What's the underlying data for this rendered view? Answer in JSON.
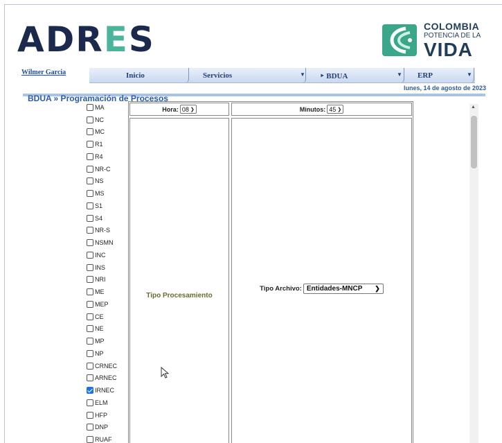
{
  "header": {
    "logo_left": "ADRES",
    "logo_right": {
      "line1": "COLOMBIA",
      "line2": "POTENCIA DE LA",
      "line3": "VIDA"
    }
  },
  "nav": {
    "user": "Wilmer Garcia",
    "items": [
      {
        "label": "Inicio"
      },
      {
        "label": "Servicios"
      },
      {
        "label": "‣ BDUA"
      },
      {
        "label": "ERP"
      }
    ],
    "date": "lunes, 14 de agosto de 2023"
  },
  "breadcrumb": "BDUA » Programación de Procesos",
  "checkboxes": [
    {
      "label": "MA",
      "checked": false
    },
    {
      "label": "NC",
      "checked": false
    },
    {
      "label": "MC",
      "checked": false
    },
    {
      "label": "R1",
      "checked": false
    },
    {
      "label": "R4",
      "checked": false
    },
    {
      "label": "NR-C",
      "checked": false
    },
    {
      "label": "NS",
      "checked": false
    },
    {
      "label": "MS",
      "checked": false
    },
    {
      "label": "S1",
      "checked": false
    },
    {
      "label": "S4",
      "checked": false
    },
    {
      "label": "NR-S",
      "checked": false
    },
    {
      "label": "NSMN",
      "checked": false
    },
    {
      "label": "INC",
      "checked": false
    },
    {
      "label": "INS",
      "checked": false
    },
    {
      "label": "NRI",
      "checked": false
    },
    {
      "label": "ME",
      "checked": false
    },
    {
      "label": "MEP",
      "checked": false
    },
    {
      "label": "CE",
      "checked": false
    },
    {
      "label": "NE",
      "checked": false
    },
    {
      "label": "MP",
      "checked": false
    },
    {
      "label": "NP",
      "checked": false
    },
    {
      "label": "CRNEC",
      "checked": false
    },
    {
      "label": "ARNEC",
      "checked": false
    },
    {
      "label": "IRNEC",
      "checked": true
    },
    {
      "label": "ELM",
      "checked": false
    },
    {
      "label": "HFP",
      "checked": false
    },
    {
      "label": "DNP",
      "checked": false
    },
    {
      "label": "RUAF",
      "checked": false
    }
  ],
  "form": {
    "hora_label": "Hora:",
    "hora_value": "08",
    "minutos_label": "Minutos:",
    "minutos_value": "45",
    "tipo_procesamiento": "Tipo Procesamiento",
    "tipo_archivo_label": "Tipo Archivo:",
    "tipo_archivo_value": "Entidades-MNCP"
  },
  "colors": {
    "brand_dark": "#1b2a4c",
    "brand_accent": "#4cb49a",
    "nav_text": "#23407a",
    "checkbox_on": "#1a73e8"
  }
}
